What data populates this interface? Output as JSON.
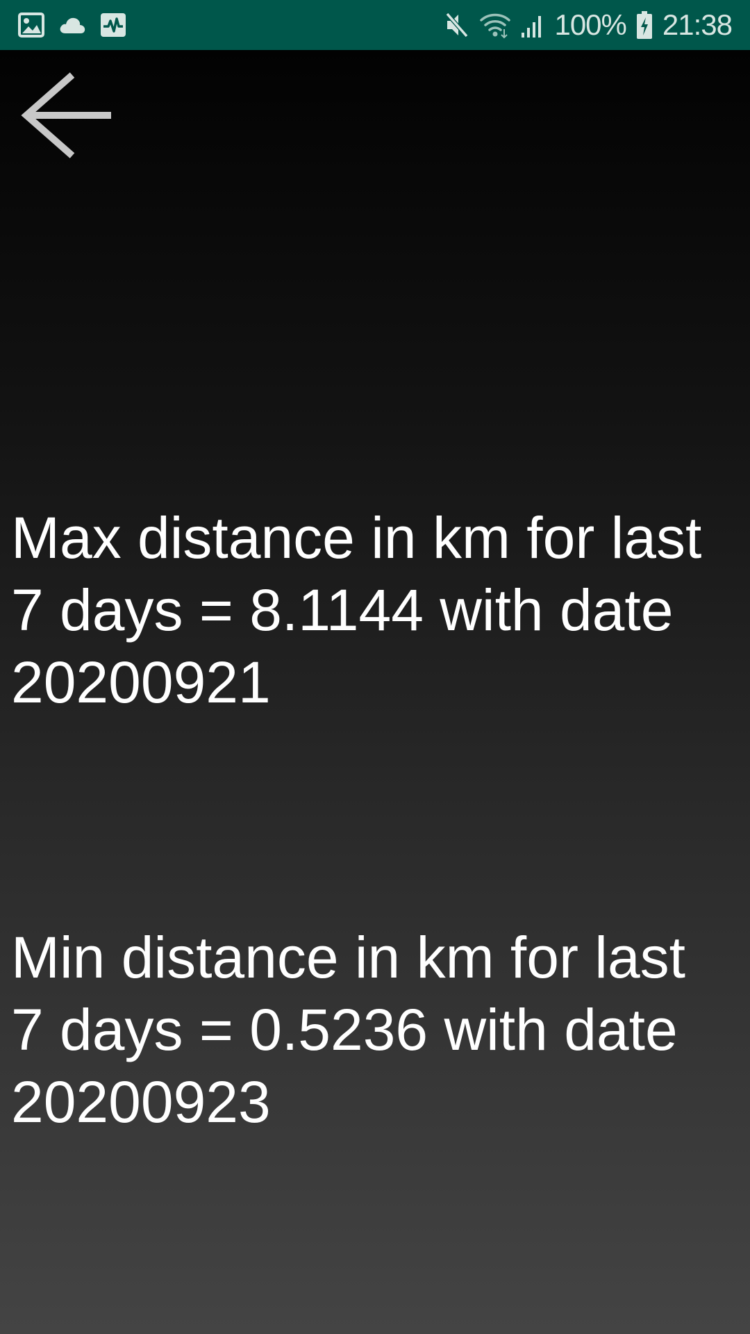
{
  "status_bar": {
    "battery": "100%",
    "time": "21:38",
    "icons": [
      "image-icon",
      "cloud-icon",
      "activity-icon",
      "mute-icon",
      "wifi-icon",
      "signal-icon",
      "battery-charging-icon"
    ]
  },
  "colors": {
    "status_bar": "#00574b",
    "text": "#ffffff",
    "back_arrow": "#c8c8c8"
  },
  "stats": {
    "max_text": "Max distance in km for last 7 days = 8.1144 with date 20200921",
    "min_text": "Min distance in km for last 7 days = 0.5236 with date 20200923"
  }
}
